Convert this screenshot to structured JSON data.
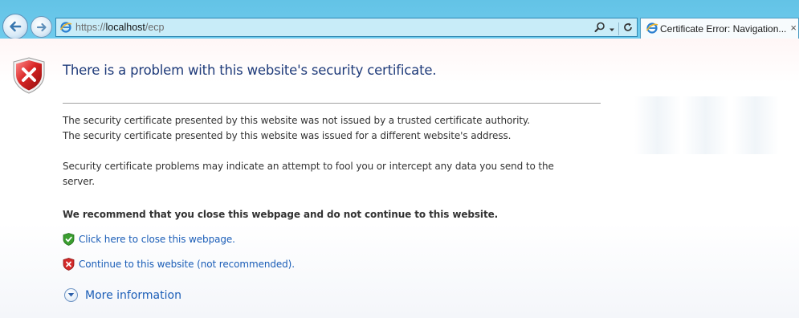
{
  "browser": {
    "address": {
      "scheme": "https://",
      "host": "localhost",
      "path": "/ecp"
    },
    "tab": {
      "title": "Certificate Error: Navigation...",
      "close_glyph": "×"
    },
    "icons": {
      "back": "back-arrow-icon",
      "forward": "forward-arrow-icon",
      "page": "ie-page-icon",
      "search": "search-icon",
      "dropdown": "dropdown-arrow-icon",
      "refresh": "refresh-icon"
    }
  },
  "page": {
    "heading": "There is a problem with this website's security certificate.",
    "paragraphs": [
      "The security certificate presented by this website was not issued by a trusted certificate authority.",
      "The security certificate presented by this website was issued for a different website's address.",
      "Security certificate problems may indicate an attempt to fool you or intercept any data you send to the",
      "server."
    ],
    "recommendation": "We recommend that you close this webpage and do not continue to this website.",
    "links": {
      "close": "Click here to close this webpage.",
      "continue": "Continue to this website (not recommended)."
    },
    "more_info": "More information"
  },
  "colors": {
    "chrome": "#6fcbed",
    "heading": "#1f3b7a",
    "link": "#1a5db7",
    "error_red": "#d42a2a",
    "safe_green": "#3a9e2f"
  }
}
